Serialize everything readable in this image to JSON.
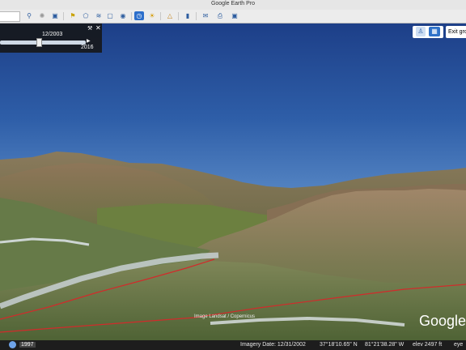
{
  "window": {
    "title": "Google Earth Pro"
  },
  "toolbar": {
    "icons": [
      "search-icon",
      "sidebar-toggle-icon",
      "placemark-icon",
      "polygon-icon",
      "path-icon",
      "image-overlay-icon",
      "record-tour-icon",
      "historical-imagery-icon",
      "sun-icon",
      "planets-icon",
      "ruler-icon",
      "email-icon",
      "print-icon",
      "save-image-icon"
    ]
  },
  "time_slider": {
    "current_date": "12/2003",
    "end_year": "2016",
    "position_fraction": 0.42
  },
  "navigation": {
    "exit_ground_label": "Exit gro"
  },
  "view": {
    "image_credit": "Image Landsat / Copernicus",
    "brand": "Google"
  },
  "statusbar": {
    "year": "1997",
    "imagery_date": "Imagery Date: 12/31/2002",
    "latitude": "37°18'10.65\" N",
    "longitude": "81°21'38.28\" W",
    "elevation": "elev  2497 ft",
    "eye_alt": "eye"
  },
  "colors": {
    "sky_top": "#1d3f88",
    "sky_horizon": "#9bbde2",
    "road_line": "#d12b2b"
  }
}
